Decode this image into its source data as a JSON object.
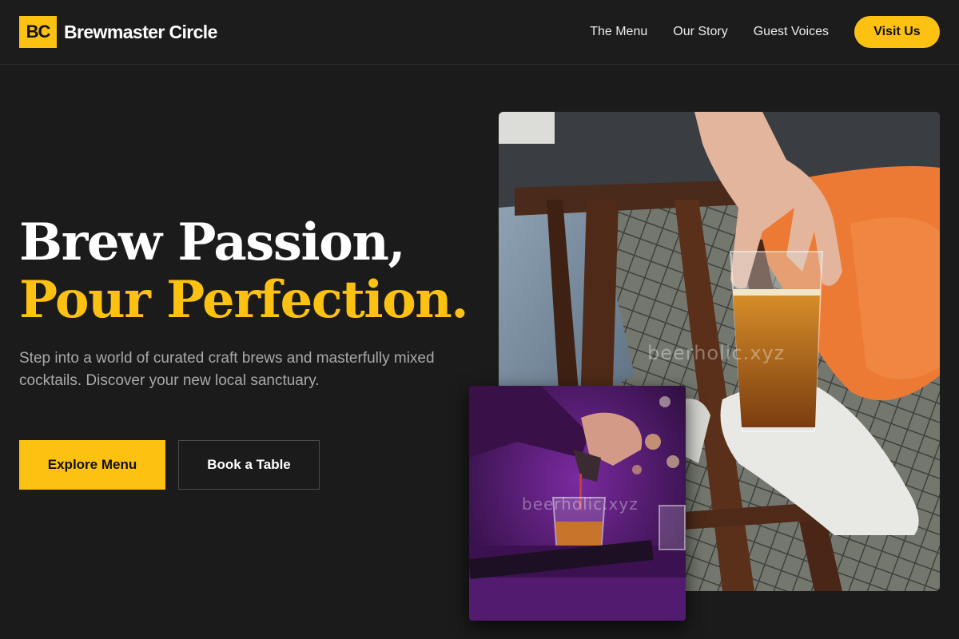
{
  "brand": {
    "badge": "BC",
    "name": "Brewmaster Circle",
    "accent_color": "#fcc111",
    "background_color": "#1b1b1b"
  },
  "nav": {
    "links": [
      "The Menu",
      "Our Story",
      "Guest Voices"
    ],
    "cta": "Visit Us"
  },
  "hero": {
    "title_line1": "Brew Passion,",
    "title_line2": "Pour Perfection.",
    "subtitle": "Step into a world of curated craft brews and masterfully mixed cocktails. Discover your new local sanctuary.",
    "primary_button": "Explore Menu",
    "secondary_button": "Book a Table"
  },
  "images": {
    "main_watermark": "beerholic.xyz",
    "small_watermark": "beerholic.xyz"
  }
}
